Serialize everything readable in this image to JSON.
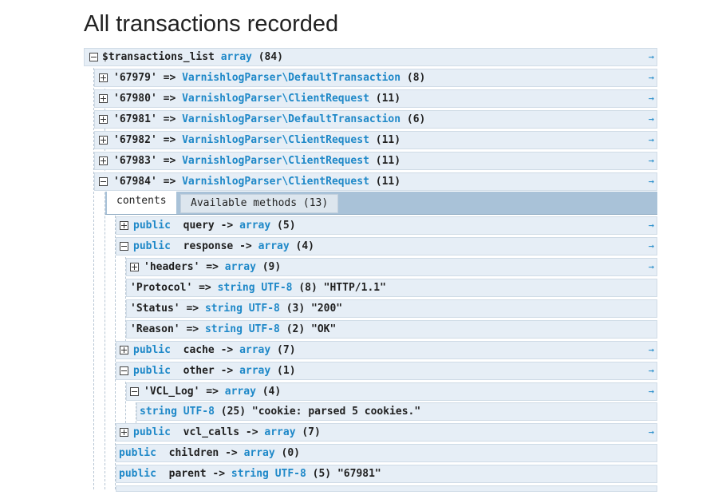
{
  "page": {
    "title": "All transactions recorded"
  },
  "tree": {
    "root": {
      "name": "$transactions_list",
      "type": "array",
      "count": "(84)"
    },
    "arrow": "→",
    "entries": [
      {
        "key": "'67979'",
        "op": "=>",
        "type": "VarnishlogParser\\DefaultTransaction",
        "count": "(8)"
      },
      {
        "key": "'67980'",
        "op": "=>",
        "type": "VarnishlogParser\\ClientRequest",
        "count": "(11)"
      },
      {
        "key": "'67981'",
        "op": "=>",
        "type": "VarnishlogParser\\DefaultTransaction",
        "count": "(6)"
      },
      {
        "key": "'67982'",
        "op": "=>",
        "type": "VarnishlogParser\\ClientRequest",
        "count": "(11)"
      },
      {
        "key": "'67983'",
        "op": "=>",
        "type": "VarnishlogParser\\ClientRequest",
        "count": "(11)"
      },
      {
        "key": "'67984'",
        "op": "=>",
        "type": "VarnishlogParser\\ClientRequest",
        "count": "(11)"
      }
    ],
    "tabs": {
      "contents": "contents",
      "methods": "Available methods (13)"
    },
    "props": {
      "query": {
        "vis": "public",
        "name": "query",
        "op": "->",
        "type": "array",
        "count": "(5)"
      },
      "response": {
        "vis": "public",
        "name": "response",
        "op": "->",
        "type": "array",
        "count": "(4)"
      },
      "headers": {
        "key": "'headers'",
        "op": "=>",
        "type": "array",
        "count": "(9)"
      },
      "protocol": {
        "key": "'Protocol'",
        "op": "=>",
        "type": "string UTF-8",
        "count": "(8)",
        "value": "\"HTTP/1.1\""
      },
      "status": {
        "key": "'Status'",
        "op": "=>",
        "type": "string UTF-8",
        "count": "(3)",
        "value": "\"200\""
      },
      "reason": {
        "key": "'Reason'",
        "op": "=>",
        "type": "string UTF-8",
        "count": "(2)",
        "value": "\"OK\""
      },
      "cache": {
        "vis": "public",
        "name": "cache",
        "op": "->",
        "type": "array",
        "count": "(7)"
      },
      "other": {
        "vis": "public",
        "name": "other",
        "op": "->",
        "type": "array",
        "count": "(1)"
      },
      "vcl_log": {
        "key": "'VCL_Log'",
        "op": "=>",
        "type": "array",
        "count": "(4)"
      },
      "vcl_string": {
        "type": "string UTF-8",
        "count": "(25)",
        "value": "\"cookie: parsed 5 cookies.\""
      },
      "vcl_calls": {
        "vis": "public",
        "name": "vcl_calls",
        "op": "->",
        "type": "array",
        "count": "(7)"
      },
      "children": {
        "vis": "public",
        "name": "children",
        "op": "->",
        "type": "array",
        "count": "(0)"
      },
      "parent": {
        "vis": "public",
        "name": "parent",
        "op": "->",
        "type": "string UTF-8",
        "count": "(5)",
        "value": "\"67981\""
      }
    }
  },
  "colors": {
    "keyword": "#1e88c8",
    "row_bg": "#e6eef6",
    "tab_bar": "#a9c2d8"
  }
}
